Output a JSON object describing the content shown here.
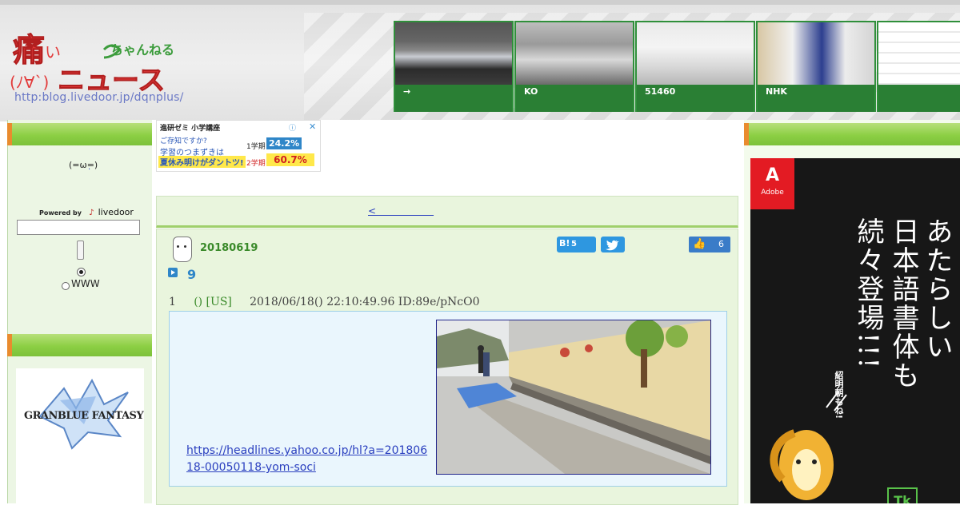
{
  "site": {
    "logo_text_main": "痛いニュース",
    "logo_text_sub": "ちゃんねる",
    "logo_face": "(ﾉ∀`)",
    "url": "http:blog.livedoor.jp/dqnplus/"
  },
  "thumbs": [
    {
      "caption": "→"
    },
    {
      "caption": "KO"
    },
    {
      "caption": "51460"
    },
    {
      "caption": "NHK"
    },
    {
      "caption": ""
    }
  ],
  "sidebar": {
    "face": "(=ω=)",
    "dot": ".",
    "powered_by": "Powered by",
    "livedoor": "livedoor",
    "search_value": "",
    "radio_site_label": "",
    "radio_www_label": "WWW",
    "banner_title": "GRANBLUE FANTASY"
  },
  "ad_top": {
    "brand": "進研ゼミ 小学講座",
    "question": "ご存知ですか?",
    "line1": "学習のつまずきは",
    "line2": "夏休み明けがダントツ!",
    "term1": "1学期",
    "value1": "24.2%",
    "term2": "2学期",
    "value2": "60.7%"
  },
  "nav": {
    "prev_link": "<　　　　　　"
  },
  "post": {
    "date": "20180619",
    "hatena_count": "5",
    "hatena_label": "B!",
    "like_count": "6",
    "title": "9",
    "res_number": "1",
    "res_name": "() [US]",
    "res_datetime": "2018/06/18() 22:10:49.96 ID:89e/pNcO0",
    "link_url": "https://headlines.yahoo.co.jp/hl?a=20180618-00050118-yom-soci"
  },
  "right_ad": {
    "badge": "Adobe",
    "line1": "あたらしい",
    "line2": "日本語書体も",
    "line3": "続々登場!!!",
    "note": "紹明朝もね!",
    "tk": "Tk"
  }
}
